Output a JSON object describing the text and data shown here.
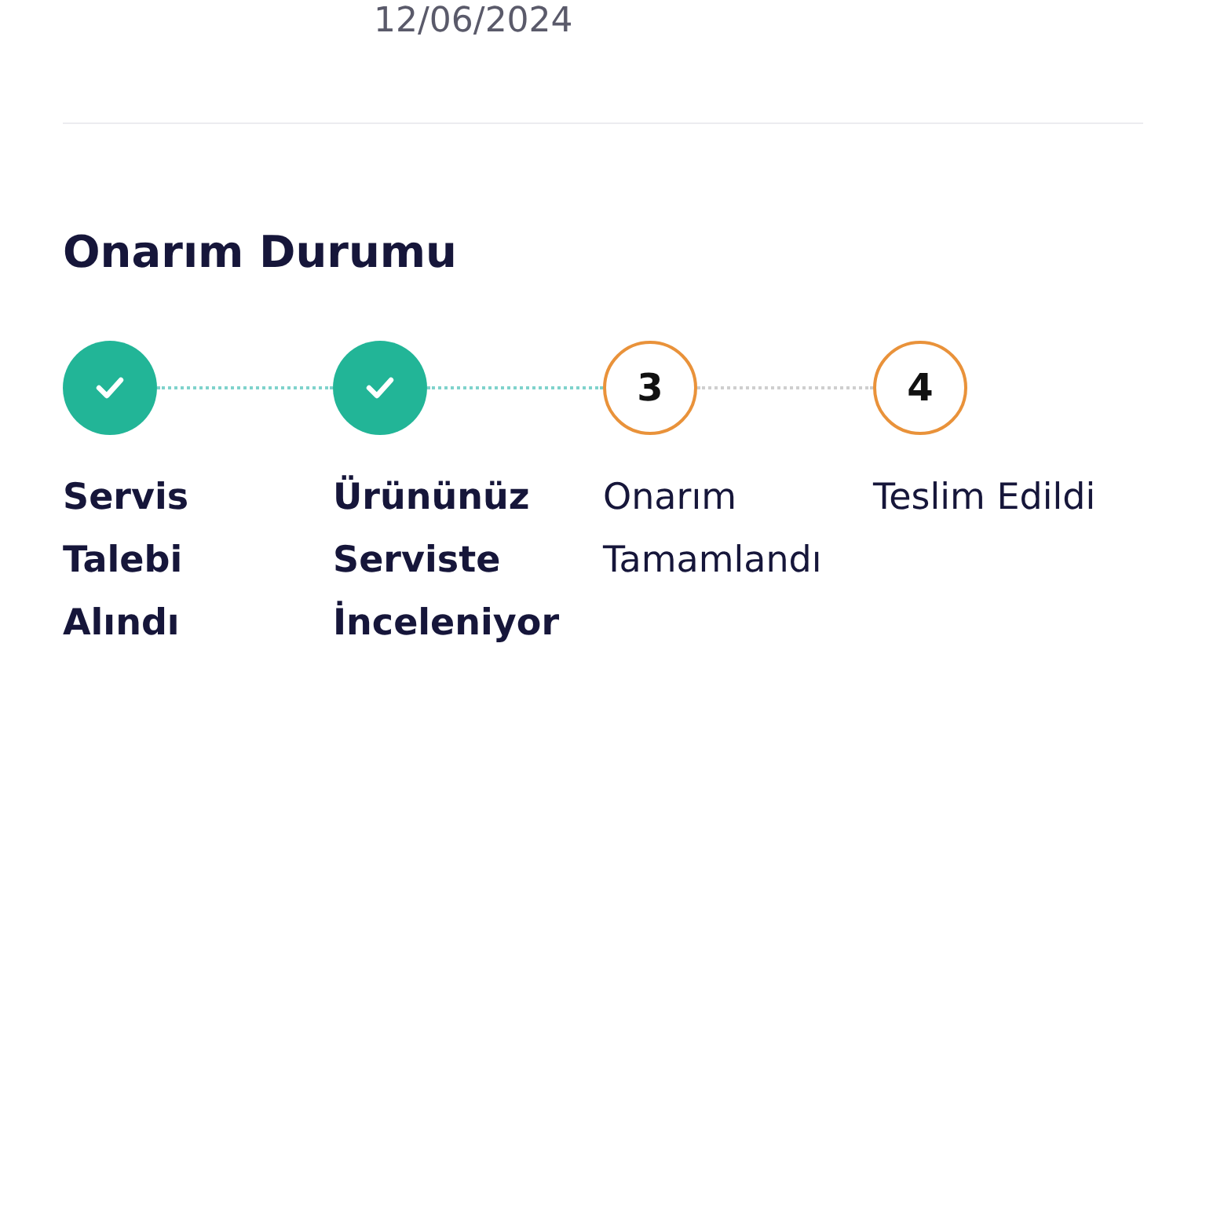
{
  "date": "12/06/2024",
  "section_title": "Onarım Durumu",
  "steps": [
    {
      "label": "Servis Talebi Alındı",
      "done": true
    },
    {
      "label": "Ürününüz Serviste İnceleniyor",
      "done": true
    },
    {
      "number": "3",
      "label": "Onarım Tamamlandı",
      "done": false
    },
    {
      "number": "4",
      "label": "Teslim Edildi",
      "done": false
    }
  ]
}
